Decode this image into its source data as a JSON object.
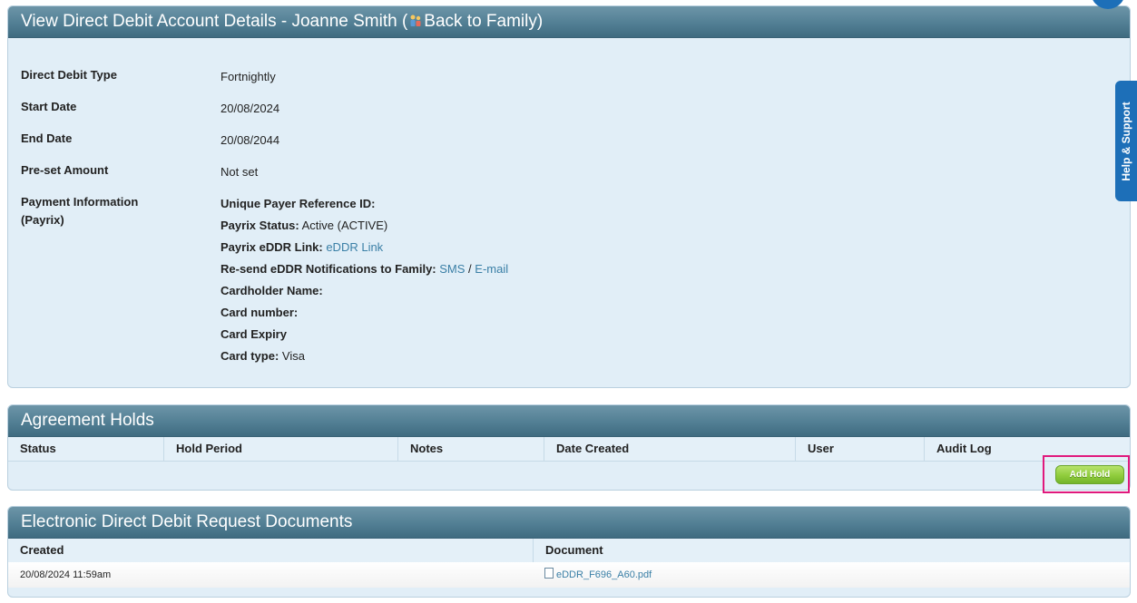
{
  "details_panel": {
    "title_prefix": "View Direct Debit Account Details - Joanne Smith (",
    "back_link": "Back to Family)",
    "rows": [
      {
        "label": "Direct Debit Type",
        "value": "Fortnightly"
      },
      {
        "label": "Start Date",
        "value": "20/08/2024"
      },
      {
        "label": "End Date",
        "value": "20/08/2044"
      },
      {
        "label": "Pre-set Amount",
        "value": "Not set"
      }
    ],
    "payment": {
      "label_line1": "Payment Information",
      "label_line2": "(Payrix)",
      "unique_ref_label": "Unique Payer Reference ID:",
      "status_label": "Payrix Status:",
      "status_value": " Active (ACTIVE)",
      "eddr_label": "Payrix eDDR Link:",
      "eddr_link": "eDDR Link",
      "resend_label": "Re-send eDDR Notifications to Family:",
      "sms_link": "SMS",
      "sep": " / ",
      "email_link": "E-mail",
      "cardholder_label": "Cardholder Name:",
      "card_number_label": "Card number:",
      "card_expiry_label": "Card Expiry",
      "card_type_label": "Card type:",
      "card_type_value": " Visa"
    }
  },
  "holds_panel": {
    "title": "Agreement Holds",
    "columns": [
      "Status",
      "Hold Period",
      "Notes",
      "Date Created",
      "User",
      "Audit Log"
    ],
    "add_button": "Add Hold"
  },
  "docs_panel": {
    "title": "Electronic Direct Debit Request Documents",
    "columns": [
      "Created",
      "Document"
    ],
    "rows": [
      {
        "created": "20/08/2024 11:59am",
        "document": "eDDR_F696_A60.pdf"
      }
    ]
  },
  "help_tab": {
    "label": "Help & Support"
  },
  "colors": {
    "accent_link": "#3a7fa6",
    "header_bg": "#527f94",
    "add_button": "#8fcc3c",
    "highlight": "#e0197d"
  }
}
